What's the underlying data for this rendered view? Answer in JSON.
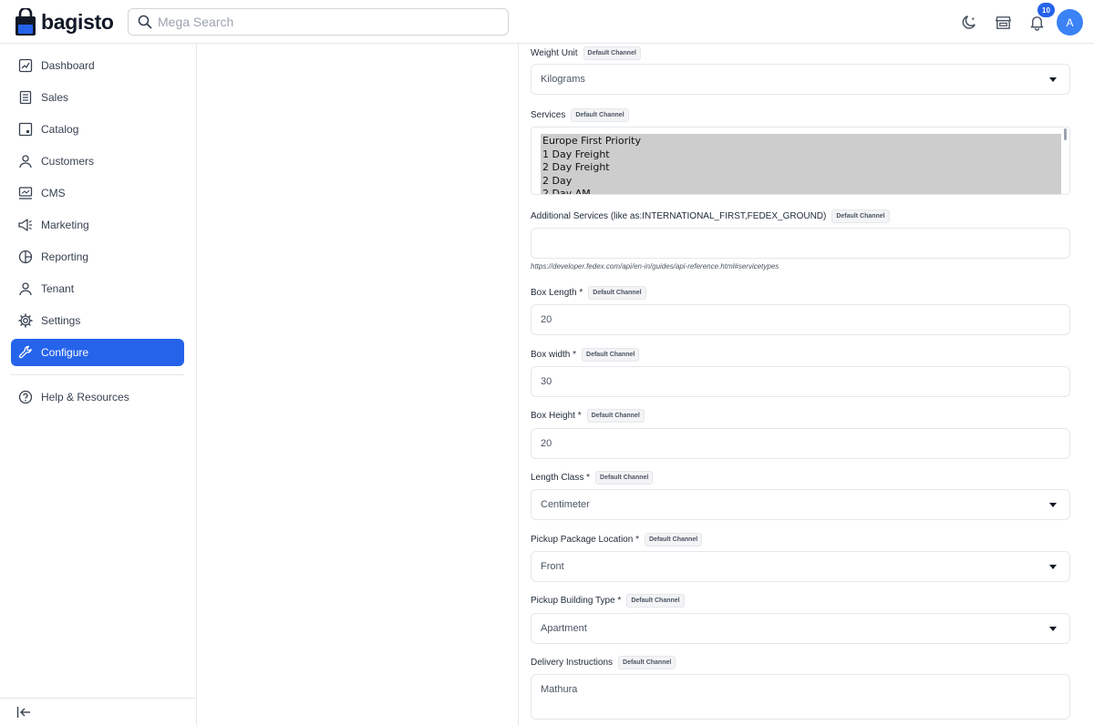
{
  "header": {
    "brand": "bagisto",
    "search_placeholder": "Mega Search",
    "notification_count": "10",
    "avatar_initial": "A"
  },
  "sidebar": {
    "items": [
      {
        "label": "Dashboard",
        "icon": "dashboard-icon"
      },
      {
        "label": "Sales",
        "icon": "receipt-icon"
      },
      {
        "label": "Catalog",
        "icon": "catalog-icon"
      },
      {
        "label": "Customers",
        "icon": "person-icon"
      },
      {
        "label": "CMS",
        "icon": "monitor-icon"
      },
      {
        "label": "Marketing",
        "icon": "megaphone-icon"
      },
      {
        "label": "Reporting",
        "icon": "pie-chart-icon"
      },
      {
        "label": "Tenant",
        "icon": "person-icon"
      },
      {
        "label": "Settings",
        "icon": "gear-icon"
      },
      {
        "label": "Configure",
        "icon": "wrench-icon",
        "active": true
      }
    ],
    "help_label": "Help & Resources"
  },
  "form": {
    "channel_chip": "Default Channel",
    "weight_unit": {
      "label": "Weight Unit",
      "value": "Kilograms"
    },
    "services": {
      "label": "Services",
      "options": [
        "Europe First Priority",
        "1 Day Freight",
        "2 Day Freight",
        "2 Day",
        "2 Day AM"
      ]
    },
    "additional_services": {
      "label": "Additional Services (like as:INTERNATIONAL_FIRST,FEDEX_GROUND)",
      "value": "",
      "hint": "https://developer.fedex.com/api/en-in/guides/api-reference.html#servicetypes"
    },
    "box_length": {
      "label": "Box Length *",
      "value": "20"
    },
    "box_width": {
      "label": "Box width *",
      "value": "30"
    },
    "box_height": {
      "label": "Box Height *",
      "value": "20"
    },
    "length_class": {
      "label": "Length Class *",
      "value": "Centimeter"
    },
    "pickup_location": {
      "label": "Pickup Package Location *",
      "value": "Front"
    },
    "pickup_building": {
      "label": "Pickup Building Type *",
      "value": "Apartment"
    },
    "delivery_instructions": {
      "label": "Delivery Instructions",
      "value": "Mathura"
    }
  }
}
